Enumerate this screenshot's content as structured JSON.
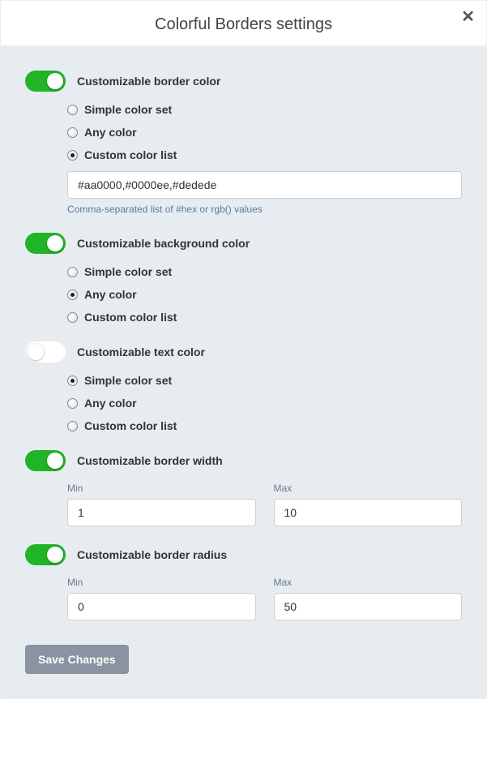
{
  "title": "Colorful Borders settings",
  "sections": {
    "borderColor": {
      "label": "Customizable border color",
      "enabled": true,
      "options": {
        "simple": "Simple color set",
        "any": "Any color",
        "custom": "Custom color list"
      },
      "selected": "custom",
      "customValue": "#aa0000,#0000ee,#dedede",
      "hint": "Comma-separated list of #hex or rgb() values"
    },
    "backgroundColor": {
      "label": "Customizable background color",
      "enabled": true,
      "options": {
        "simple": "Simple color set",
        "any": "Any color",
        "custom": "Custom color list"
      },
      "selected": "any"
    },
    "textColor": {
      "label": "Customizable text color",
      "enabled": false,
      "options": {
        "simple": "Simple color set",
        "any": "Any color",
        "custom": "Custom color list"
      },
      "selected": "simple"
    },
    "borderWidth": {
      "label": "Customizable border width",
      "enabled": true,
      "minLabel": "Min",
      "maxLabel": "Max",
      "min": "1",
      "max": "10"
    },
    "borderRadius": {
      "label": "Customizable border radius",
      "enabled": true,
      "minLabel": "Min",
      "maxLabel": "Max",
      "min": "0",
      "max": "50"
    }
  },
  "saveLabel": "Save Changes"
}
